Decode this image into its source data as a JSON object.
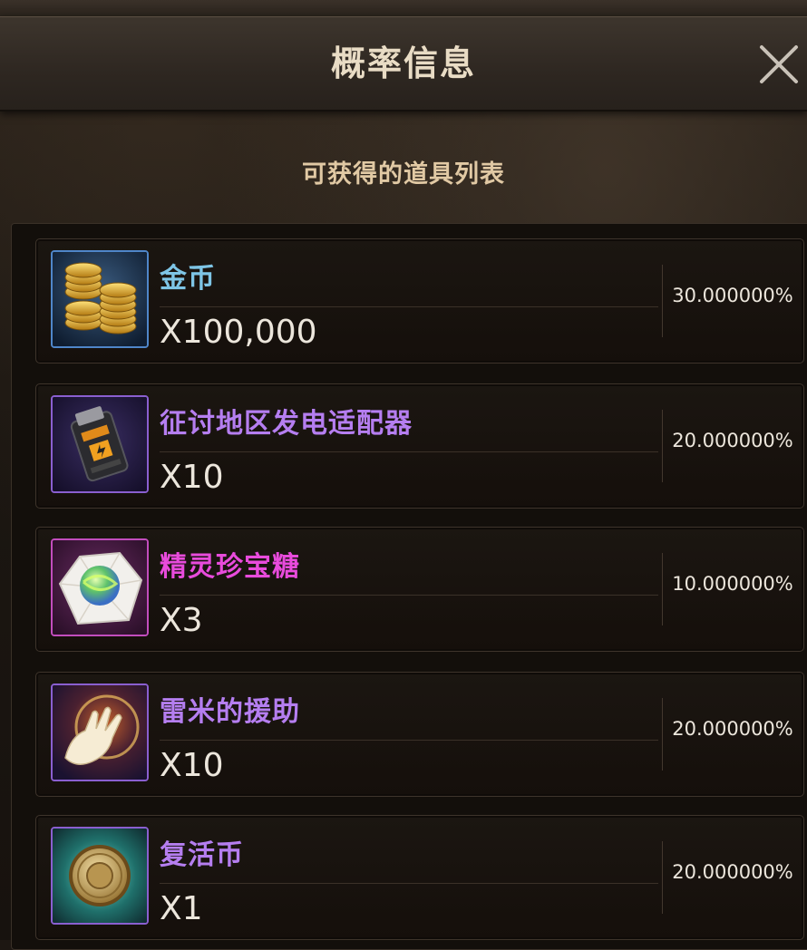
{
  "dialog": {
    "title": "概率信息",
    "subtitle": "可获得的道具列表"
  },
  "items": [
    {
      "name": "金币",
      "quantity": "X100,000",
      "probability": "30.000000%",
      "name_color": "#7ec5e6",
      "icon": "gold-coins-icon"
    },
    {
      "name": "征讨地区发电适配器",
      "quantity": "X10",
      "probability": "20.000000%",
      "name_color": "#b57ef0",
      "icon": "power-adapter-icon"
    },
    {
      "name": "精灵珍宝糖",
      "quantity": "X3",
      "probability": "10.000000%",
      "name_color": "#e84bdc",
      "icon": "candy-icon"
    },
    {
      "name": "雷米的援助",
      "quantity": "X10",
      "probability": "20.000000%",
      "name_color": "#b57ef0",
      "icon": "glove-icon"
    },
    {
      "name": "复活币",
      "quantity": "X1",
      "probability": "20.000000%",
      "name_color": "#b57ef0",
      "icon": "revive-coin-icon"
    }
  ]
}
